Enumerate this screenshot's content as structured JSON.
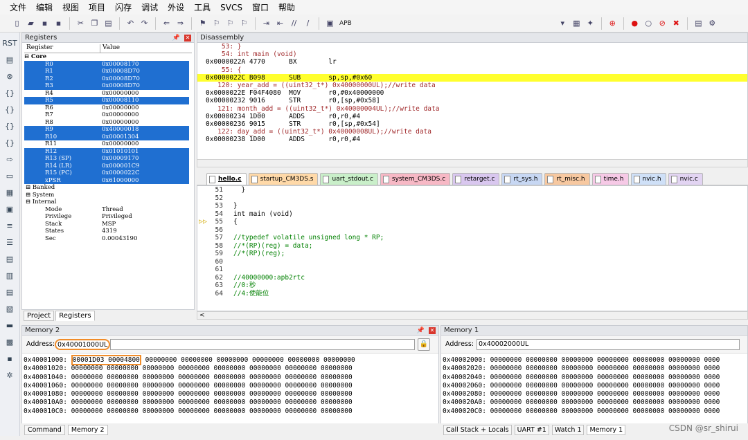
{
  "menu": [
    "文件",
    "编辑",
    "视图",
    "项目",
    "闪存",
    "调试",
    "外设",
    "工具",
    "SVCS",
    "窗口",
    "帮助"
  ],
  "toolbar": {
    "apb_label": "APB"
  },
  "registers": {
    "title": "Registers",
    "col_register": "Register",
    "col_value": "Value",
    "core_label": "Core",
    "rows": [
      {
        "name": "R0",
        "value": "0x00008170",
        "sel": true
      },
      {
        "name": "R1",
        "value": "0x00008D70",
        "sel": true
      },
      {
        "name": "R2",
        "value": "0x00008D70",
        "sel": true
      },
      {
        "name": "R3",
        "value": "0x00008D70",
        "sel": true
      },
      {
        "name": "R4",
        "value": "0x00000000",
        "sel": false
      },
      {
        "name": "R5",
        "value": "0x00008110",
        "sel": true
      },
      {
        "name": "R6",
        "value": "0x00000000",
        "sel": false
      },
      {
        "name": "R7",
        "value": "0x00000000",
        "sel": false
      },
      {
        "name": "R8",
        "value": "0x00000000",
        "sel": false
      },
      {
        "name": "R9",
        "value": "0x40000018",
        "sel": true
      },
      {
        "name": "R10",
        "value": "0x00001304",
        "sel": true
      },
      {
        "name": "R11",
        "value": "0x00000000",
        "sel": false
      },
      {
        "name": "R12",
        "value": "0x01010101",
        "sel": true
      },
      {
        "name": "R13 (SP)",
        "value": "0x00009170",
        "sel": true
      },
      {
        "name": "R14 (LR)",
        "value": "0x000001C9",
        "sel": true
      },
      {
        "name": "R15 (PC)",
        "value": "0x0000022C",
        "sel": true
      },
      {
        "name": "xPSR",
        "value": "0x61000000",
        "sel": true
      }
    ],
    "banked": "Banked",
    "system": "System",
    "internal": "Internal",
    "internal_rows": [
      {
        "name": "Mode",
        "value": "Thread"
      },
      {
        "name": "Privilege",
        "value": "Privileged"
      },
      {
        "name": "Stack",
        "value": "MSP"
      },
      {
        "name": "States",
        "value": "4319"
      },
      {
        "name": "Sec",
        "value": "0.00043190"
      }
    ],
    "tab_project": "Project",
    "tab_registers": "Registers"
  },
  "disassembly": {
    "title": "Disassembly",
    "lines": [
      {
        "t": "src",
        "text": "    53: }"
      },
      {
        "t": "src",
        "text": "    54: int main (void)"
      },
      {
        "t": "asm",
        "text": "0x0000022A 4770      BX        lr"
      },
      {
        "t": "src",
        "text": "    55: {"
      },
      {
        "t": "cur",
        "text": "0x0000022C B098      SUB       sp,sp,#0x60"
      },
      {
        "t": "src",
        "text": "   120: year_add = ((uint32_t*) 0x40000000UL);//write data"
      },
      {
        "t": "asm",
        "text": "0x0000022E F04F4080  MOV       r0,#0x40000000"
      },
      {
        "t": "asm",
        "text": "0x00000232 9016      STR       r0,[sp,#0x58]"
      },
      {
        "t": "src",
        "text": "   121: month_add = ((uint32_t*) 0x40000004UL);//write data"
      },
      {
        "t": "asm",
        "text": "0x00000234 1D00      ADDS      r0,r0,#4"
      },
      {
        "t": "asm",
        "text": "0x00000236 9015      STR       r0,[sp,#0x54]"
      },
      {
        "t": "src",
        "text": "   122: day_add = ((uint32_t*) 0x40000008UL);//write data"
      },
      {
        "t": "asm",
        "text": "0x00000238 1D00      ADDS      r0,r0,#4"
      }
    ]
  },
  "file_tabs": [
    {
      "name": "hello.c",
      "color": "#fffbd0",
      "active": true
    },
    {
      "name": "startup_CM3DS.s",
      "color": "#ffd9a8"
    },
    {
      "name": "uart_stdout.c",
      "color": "#c9efc9"
    },
    {
      "name": "system_CM3DS.c",
      "color": "#f7b8c5"
    },
    {
      "name": "retarget.c",
      "color": "#d9c7ef"
    },
    {
      "name": "rt_sys.h",
      "color": "#c7d7f3"
    },
    {
      "name": "rt_misc.h",
      "color": "#f7c8a0"
    },
    {
      "name": "time.h",
      "color": "#f6c9e6"
    },
    {
      "name": "nvic.h",
      "color": "#cfe0f7"
    },
    {
      "name": "nvic.c",
      "color": "#e2d4f2"
    }
  ],
  "code": [
    {
      "ln": "51",
      "text": "  }",
      "cls": ""
    },
    {
      "ln": "52",
      "text": "",
      "cls": ""
    },
    {
      "ln": "53",
      "text": "}",
      "cls": ""
    },
    {
      "ln": "54",
      "text": "int main (void)",
      "cls": "kwline"
    },
    {
      "ln": "55",
      "text": "{",
      "cls": "arrow"
    },
    {
      "ln": "56",
      "text": "",
      "cls": ""
    },
    {
      "ln": "57",
      "text": "//typedef volatile unsigned long * RP;",
      "cls": "cmt"
    },
    {
      "ln": "58",
      "text": "//*(RP)(reg) = data;",
      "cls": "cmt"
    },
    {
      "ln": "59",
      "text": "//*(RP)(reg);",
      "cls": "cmt"
    },
    {
      "ln": "60",
      "text": "",
      "cls": ""
    },
    {
      "ln": "61",
      "text": "",
      "cls": ""
    },
    {
      "ln": "62",
      "text": "//40000000:apb2rtc",
      "cls": "cmt"
    },
    {
      "ln": "63",
      "text": "//0:秒",
      "cls": "cmt"
    },
    {
      "ln": "64",
      "text": "//4:使能位",
      "cls": "cmt"
    }
  ],
  "memory2": {
    "title": "Memory 2",
    "address_label": "Address:",
    "address_value": "0x40001000UL",
    "rows": [
      {
        "addr": "0x40001000:",
        "hl": "00001D03 00004800",
        "rest": "00000000 00000000 00000000 00000000 00000000 00000000"
      },
      {
        "addr": "0x40001020:",
        "hl": "",
        "rest": "00000000 00000000 00000000 00000000 00000000 00000000 00000000 00000000"
      },
      {
        "addr": "0x40001040:",
        "hl": "",
        "rest": "00000000 00000000 00000000 00000000 00000000 00000000 00000000 00000000"
      },
      {
        "addr": "0x40001060:",
        "hl": "",
        "rest": "00000000 00000000 00000000 00000000 00000000 00000000 00000000 00000000"
      },
      {
        "addr": "0x40001080:",
        "hl": "",
        "rest": "00000000 00000000 00000000 00000000 00000000 00000000 00000000 00000000"
      },
      {
        "addr": "0x400010A0:",
        "hl": "",
        "rest": "00000000 00000000 00000000 00000000 00000000 00000000 00000000 00000000"
      },
      {
        "addr": "0x400010C0:",
        "hl": "",
        "rest": "00000000 00000000 00000000 00000000 00000000 00000000 00000000 00000000"
      }
    ]
  },
  "memory1": {
    "title": "Memory 1",
    "address_label": "Address:",
    "address_value": "0x40002000UL",
    "rows": [
      "0x40002000: 00000000 00000000 00000000 00000000 00000000 00000000 0000",
      "0x40002020: 00000000 00000000 00000000 00000000 00000000 00000000 0000",
      "0x40002040: 00000000 00000000 00000000 00000000 00000000 00000000 0000",
      "0x40002060: 00000000 00000000 00000000 00000000 00000000 00000000 0000",
      "0x40002080: 00000000 00000000 00000000 00000000 00000000 00000000 0000",
      "0x400020A0: 00000000 00000000 00000000 00000000 00000000 00000000 0000",
      "0x400020C0: 00000000 00000000 00000000 00000000 00000000 00000000 0000"
    ]
  },
  "bottom_left_tabs": [
    "Command",
    "Memory 2"
  ],
  "bottom_right_tabs": [
    "Call Stack + Locals",
    "UART #1",
    "Watch 1",
    "Memory 1"
  ],
  "watermark": "CSDN @sr_shirui"
}
